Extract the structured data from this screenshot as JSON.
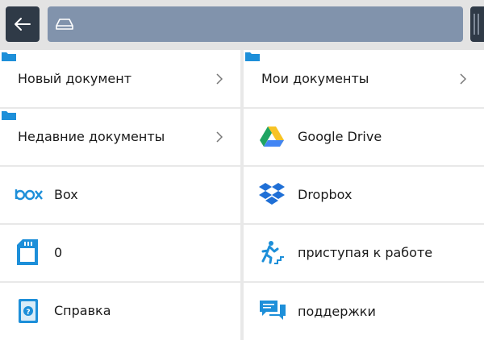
{
  "header": {
    "back_icon": "arrow-left-icon",
    "address_icon": "drive-icon"
  },
  "items": [
    {
      "label": "Новый документ",
      "icon": "folder-icon",
      "chevron": true
    },
    {
      "label": "Мои документы",
      "icon": "folder-icon",
      "chevron": true
    },
    {
      "label": "Недавние документы",
      "icon": "folder-icon",
      "chevron": true
    },
    {
      "label": "Google Drive",
      "icon": "google-drive-icon"
    },
    {
      "label": "Box",
      "icon": "box-logo-icon"
    },
    {
      "label": "Dropbox",
      "icon": "dropbox-icon"
    },
    {
      "label": "0",
      "icon": "sd-card-icon"
    },
    {
      "label": "приступая к работе",
      "icon": "running-person-icon"
    },
    {
      "label": "Справка",
      "icon": "help-icon"
    },
    {
      "label": "поддержки",
      "icon": "chat-icon"
    }
  ],
  "colors": {
    "topbar": "#e3e3e3",
    "button_dark": "#2f3a47",
    "address_bar": "#8193ac",
    "accent_blue": "#1d8fd9",
    "divider": "#e8e8e8"
  }
}
